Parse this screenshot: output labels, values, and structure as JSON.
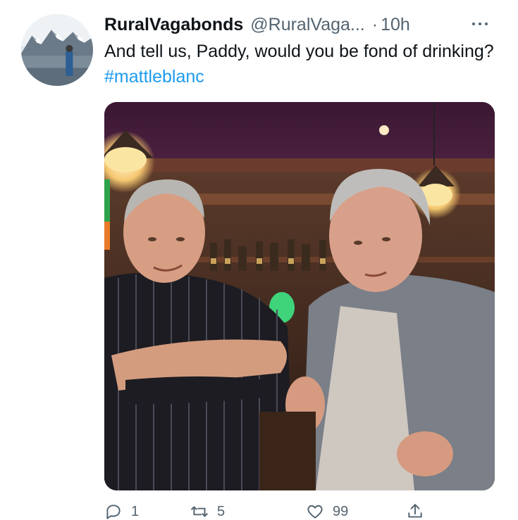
{
  "tweet": {
    "author_name": "RuralVagabonds",
    "author_handle": "@RuralVaga...",
    "separator": "·",
    "timestamp": "10h",
    "text_main": "And tell us, Paddy, would you be fond of drinking?",
    "hashtag": "#mattleblanc",
    "more_icon": "more-horizontal-icon",
    "avatar_icon": "avatar-mountain-landscape",
    "media_description_icon": "photo"
  },
  "actions": {
    "reply_count": "1",
    "retweet_count": "5",
    "like_count": "99",
    "reply_icon": "reply-icon",
    "retweet_icon": "retweet-icon",
    "like_icon": "heart-icon",
    "share_icon": "share-icon"
  },
  "colors": {
    "text": "#0f1419",
    "secondary": "#536471",
    "link": "#1d9bf0",
    "background": "#ffffff"
  }
}
